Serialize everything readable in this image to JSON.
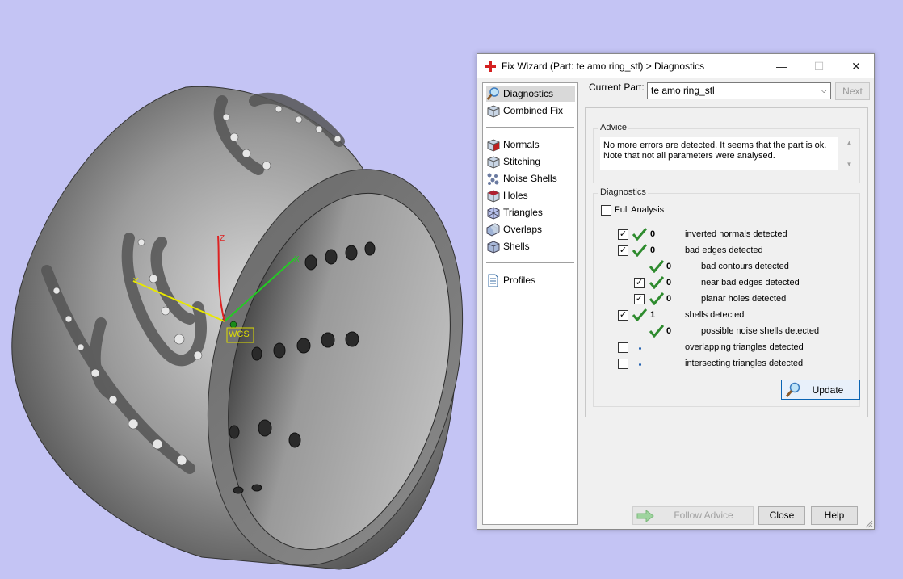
{
  "viewport": {
    "axis_z_label": "Z",
    "axis_y_label": "Y",
    "axis_x_label": "X",
    "wcs_label": "WCS",
    "background_color": "#c4c4f4"
  },
  "dialog": {
    "title": "Fix Wizard (Part: te amo ring_stl) > Diagnostics",
    "title_icon": "red-cross-icon",
    "controls": {
      "minimize": "—",
      "maximize": "☐",
      "close": "✕"
    }
  },
  "nav": {
    "top_items": [
      {
        "label": "Diagnostics",
        "icon": "magnifier-icon",
        "selected": true
      },
      {
        "label": "Combined Fix",
        "icon": "cube-icon"
      }
    ],
    "tool_items": [
      {
        "label": "Normals",
        "icon": "cube-red-face-icon"
      },
      {
        "label": "Stitching",
        "icon": "cube-icon"
      },
      {
        "label": "Noise Shells",
        "icon": "noise-shells-icon"
      },
      {
        "label": "Holes",
        "icon": "cube-holes-icon"
      },
      {
        "label": "Triangles",
        "icon": "triangles-icon"
      },
      {
        "label": "Overlaps",
        "icon": "overlaps-icon"
      },
      {
        "label": "Shells",
        "icon": "shells-icon"
      }
    ],
    "bottom_items": [
      {
        "label": "Profiles",
        "icon": "document-icon"
      }
    ]
  },
  "current_part": {
    "label": "Current Part:",
    "value": "te amo ring_stl",
    "next_label": "Next"
  },
  "advice": {
    "title": "Advice",
    "text": "No more errors are detected. It seems that the part is ok. Note that not all parameters were analysed."
  },
  "diagnostics": {
    "title": "Diagnostics",
    "full_analysis_label": "Full Analysis",
    "full_analysis_checked": false,
    "rows": [
      {
        "checkbox": true,
        "checked": true,
        "status": "ok",
        "count": "0",
        "label": "inverted normals detected",
        "level": 0
      },
      {
        "checkbox": true,
        "checked": true,
        "status": "ok",
        "count": "0",
        "label": "bad edges detected",
        "level": 0
      },
      {
        "checkbox": false,
        "checked": false,
        "status": "ok",
        "count": "0",
        "label": "bad contours detected",
        "level": 1
      },
      {
        "checkbox": true,
        "checked": true,
        "status": "ok",
        "count": "0",
        "label": "near bad edges detected",
        "level": 1
      },
      {
        "checkbox": true,
        "checked": true,
        "status": "ok",
        "count": "0",
        "label": "planar holes detected",
        "level": 1
      },
      {
        "checkbox": true,
        "checked": true,
        "status": "ok",
        "count": "1",
        "label": "shells detected",
        "level": 0
      },
      {
        "checkbox": false,
        "checked": false,
        "status": "ok",
        "count": "0",
        "label": "possible noise shells detected",
        "level": 1
      },
      {
        "checkbox": true,
        "checked": false,
        "status": "pending",
        "count": "",
        "label": "overlapping triangles detected",
        "level": 0
      },
      {
        "checkbox": true,
        "checked": false,
        "status": "pending",
        "count": "",
        "label": "intersecting triangles detected",
        "level": 0
      }
    ],
    "update_label": "Update"
  },
  "buttons": {
    "follow_advice": "Follow Advice",
    "close": "Close",
    "help": "Help"
  },
  "colors": {
    "check_green": "#2e8b2e",
    "accent_blue": "#0a64b4",
    "axis_x": "#22cc22",
    "axis_y": "#e8e800",
    "axis_z": "#dd2222"
  }
}
